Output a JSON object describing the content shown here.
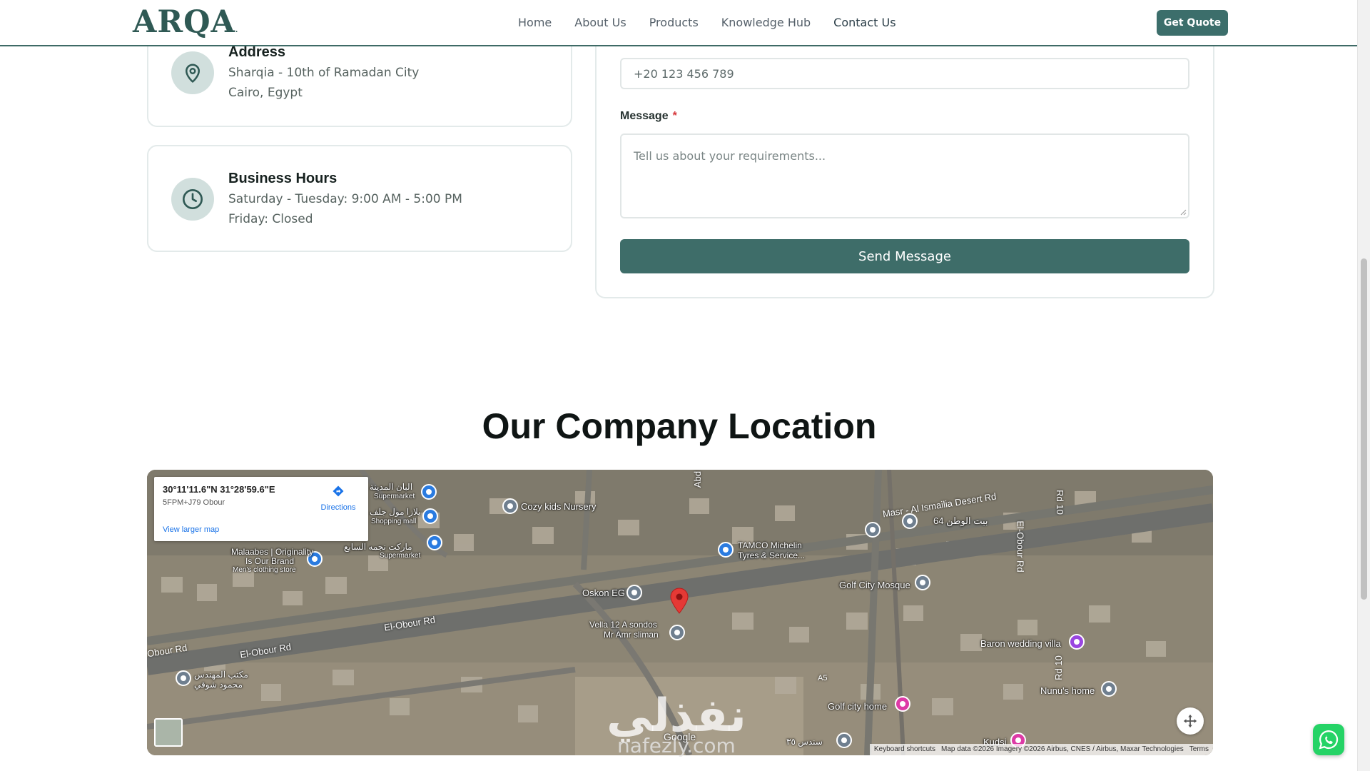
{
  "header": {
    "logo": "ARQA",
    "nav": [
      "Home",
      "About Us",
      "Products",
      "Knowledge Hub",
      "Contact Us"
    ],
    "active_nav": "Contact Us",
    "cta": "Get Quote",
    "brand_color": "#3c6e6b"
  },
  "contact_cards": {
    "address": {
      "title": "Address",
      "line1": "Sharqia - 10th of Ramadan City",
      "line2": "Cairo, Egypt",
      "icon": "map-pin-icon"
    },
    "hours": {
      "title": "Business Hours",
      "line1": "Saturday - Tuesday: 9:00 AM - 5:00 PM",
      "line2": "Friday: Closed",
      "icon": "clock-icon"
    }
  },
  "form": {
    "phone_placeholder": "+20 123 456 789",
    "message_label": "Message",
    "required_mark": "*",
    "message_placeholder": "Tell us about your requirements...",
    "submit": "Send Message"
  },
  "location": {
    "title": "Our Company Location"
  },
  "map": {
    "coords": "30°11'11.6\"N 31°28'59.6\"E",
    "plus_code": "5FPM+J79 Obour",
    "directions": "Directions",
    "larger_map": "View larger map",
    "google": "Google",
    "attribution": {
      "shortcuts": "Keyboard shortcuts",
      "data": "Map data ©2026 Imagery ©2026 Airbus, CNES / Airbus, Maxar Technologies",
      "terms": "Terms"
    },
    "roads": {
      "obour1": "El-Obour Rd",
      "obour2": "El-Obour Rd",
      "obour3": "Obour Rd",
      "masr": "Masr - Al Ismailia Desert Rd",
      "rd10a": "Rd 10",
      "rd10b": "Rd 10",
      "elobour_v": "El-Obour Rd",
      "abd": "Abd",
      "a5": "A5"
    },
    "places": {
      "cozy": "Cozy kids Nursery",
      "tamco1": "TAMCO Michelin",
      "tamco2": "Tyres & Service...",
      "oskon": "Oskon EG",
      "vella1": "Vella 12 A sondos",
      "vella2": "Mr Amr sliman",
      "golfmosque": "Golf City Mosque",
      "baron": "Baron wedding villa",
      "nunu": "Nunu's home",
      "golfhome": "Golf city home",
      "kudsi": "Kudsi",
      "malaabes1": "Malaabes | Originality",
      "malaabes2": "Is Our Brand",
      "malaabes3": "Men's clothing store",
      "watan": "بيت الوطن 64",
      "albaan": "البان المدينة",
      "albaan_sub": "Supermarket",
      "plaza": "بلازا مول جلف",
      "plaza_sub": "Shopping mall",
      "market": "ماركت نجمه السابع",
      "market_sub": "Supermarket",
      "office1": "مكتب المهندس",
      "office2": "محمود شوقي",
      "sondos": "سندس ٣٥"
    }
  },
  "watermark": {
    "main": "نفذلي",
    "sub": "nafezly.com"
  }
}
